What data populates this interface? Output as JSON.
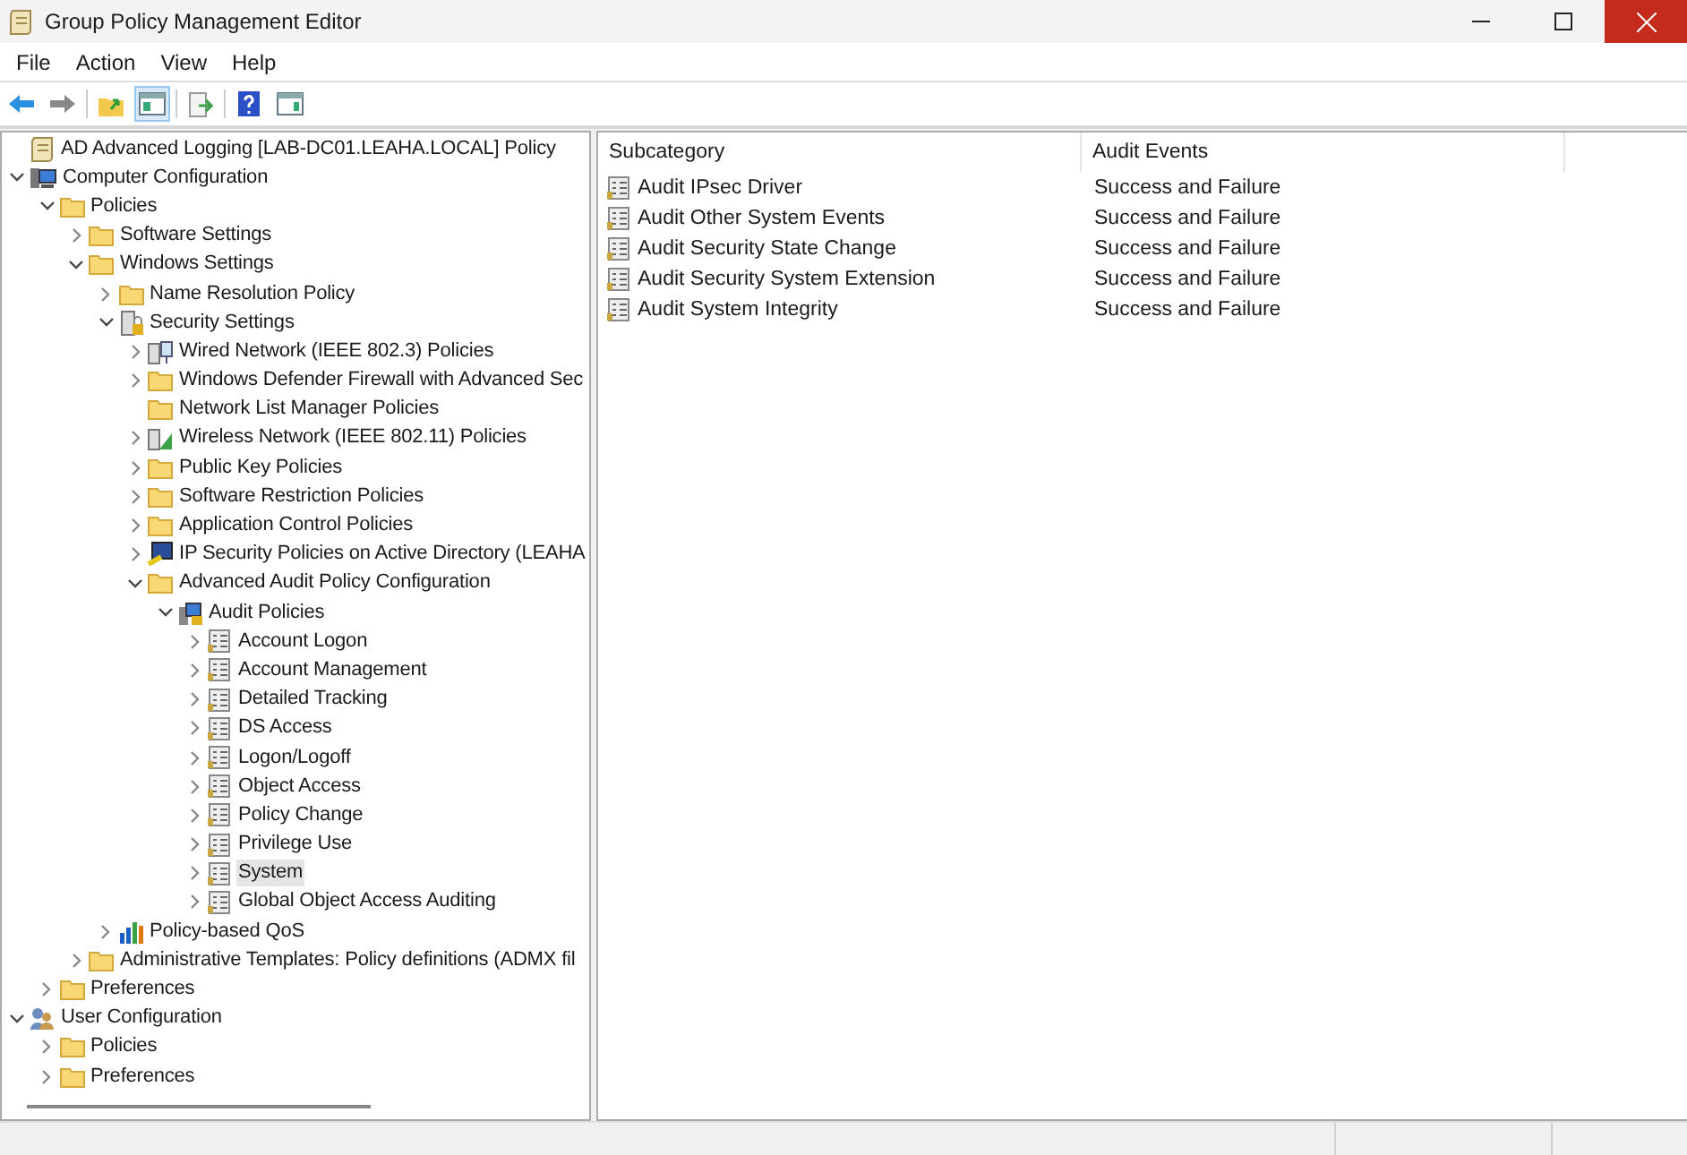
{
  "window": {
    "title": "Group Policy Management Editor"
  },
  "menu": [
    "File",
    "Action",
    "View",
    "Help"
  ],
  "toolbar": [
    {
      "kind": "back"
    },
    {
      "kind": "forward"
    },
    {
      "kind": "sep"
    },
    {
      "kind": "up"
    },
    {
      "kind": "tree",
      "selected": true
    },
    {
      "kind": "sep"
    },
    {
      "kind": "export"
    },
    {
      "kind": "sep"
    },
    {
      "kind": "help"
    },
    {
      "kind": "pane"
    }
  ],
  "tree": [
    {
      "label": "AD Advanced Logging [LAB-DC01.LEAHA.LOCAL] Policy",
      "kind": "doc",
      "selected": false
    },
    {
      "label": "Computer Configuration",
      "kind": "computer",
      "expanded": true,
      "selected": false,
      "children": [
        {
          "label": "Policies",
          "kind": "folder",
          "expanded": true,
          "selected": false,
          "children": [
            {
              "label": "Software Settings",
              "kind": "folder",
              "expanded": false,
              "selected": false
            },
            {
              "label": "Windows Settings",
              "kind": "folder",
              "expanded": true,
              "selected": false,
              "children": [
                {
                  "label": "Name Resolution Policy",
                  "kind": "folder",
                  "expanded": false,
                  "selected": false
                },
                {
                  "label": "Security Settings",
                  "kind": "security",
                  "expanded": true,
                  "selected": false,
                  "children": [
                    {
                      "label": "Wired Network (IEEE 802.3) Policies",
                      "kind": "wired",
                      "expanded": false,
                      "selected": false
                    },
                    {
                      "label": "Windows Defender Firewall with Advanced Sec",
                      "kind": "folder",
                      "expanded": false,
                      "selected": false
                    },
                    {
                      "label": "Network List Manager Policies",
                      "kind": "folder",
                      "selected": false
                    },
                    {
                      "label": "Wireless Network (IEEE 802.11) Policies",
                      "kind": "wireless",
                      "expanded": false,
                      "selected": false
                    },
                    {
                      "label": "Public Key Policies",
                      "kind": "folder",
                      "expanded": false,
                      "selected": false
                    },
                    {
                      "label": "Software Restriction Policies",
                      "kind": "folder",
                      "expanded": false,
                      "selected": false
                    },
                    {
                      "label": "Application Control Policies",
                      "kind": "folder",
                      "expanded": false,
                      "selected": false
                    },
                    {
                      "label": "IP Security Policies on Active Directory (LEAHA",
                      "kind": "ipsec",
                      "expanded": false,
                      "selected": false
                    },
                    {
                      "label": "Advanced Audit Policy Configuration",
                      "kind": "folder",
                      "expanded": true,
                      "selected": false,
                      "children": [
                        {
                          "label": "Audit Policies",
                          "kind": "audit",
                          "expanded": true,
                          "selected": false,
                          "children": [
                            {
                              "label": "Account Logon",
                              "kind": "list",
                              "expanded": false,
                              "selected": false
                            },
                            {
                              "label": "Account Management",
                              "kind": "list",
                              "expanded": false,
                              "selected": false
                            },
                            {
                              "label": "Detailed Tracking",
                              "kind": "list",
                              "expanded": false,
                              "selected": false
                            },
                            {
                              "label": "DS Access",
                              "kind": "list",
                              "expanded": false,
                              "selected": false
                            },
                            {
                              "label": "Logon/Logoff",
                              "kind": "list",
                              "expanded": false,
                              "selected": false
                            },
                            {
                              "label": "Object Access",
                              "kind": "list",
                              "expanded": false,
                              "selected": false
                            },
                            {
                              "label": "Policy Change",
                              "kind": "list",
                              "expanded": false,
                              "selected": false
                            },
                            {
                              "label": "Privilege Use",
                              "kind": "list",
                              "expanded": false,
                              "selected": false
                            },
                            {
                              "label": "System",
                              "kind": "list",
                              "expanded": false,
                              "selected": true
                            },
                            {
                              "label": "Global Object Access Auditing",
                              "kind": "list",
                              "expanded": false,
                              "selected": false
                            }
                          ]
                        }
                      ]
                    }
                  ]
                },
                {
                  "label": "Policy-based QoS",
                  "kind": "qos",
                  "expanded": false,
                  "selected": false
                }
              ]
            },
            {
              "label": "Administrative Templates: Policy definitions (ADMX fil",
              "kind": "folder",
              "expanded": false,
              "selected": false
            }
          ]
        },
        {
          "label": "Preferences",
          "kind": "folder",
          "expanded": false,
          "selected": false
        }
      ]
    },
    {
      "label": "User Configuration",
      "kind": "user",
      "expanded": true,
      "selected": false,
      "children": [
        {
          "label": "Policies",
          "kind": "folder",
          "expanded": false,
          "selected": false
        },
        {
          "label": "Preferences",
          "kind": "folder",
          "expanded": false,
          "selected": false
        }
      ]
    }
  ],
  "table": {
    "columns": [
      "Subcategory",
      "Audit Events"
    ],
    "rows": [
      {
        "subcategory": "Audit IPsec Driver",
        "audit_events": "Success and Failure"
      },
      {
        "subcategory": "Audit Other System Events",
        "audit_events": "Success and Failure"
      },
      {
        "subcategory": "Audit Security State Change",
        "audit_events": "Success and Failure"
      },
      {
        "subcategory": "Audit Security System Extension",
        "audit_events": "Success and Failure"
      },
      {
        "subcategory": "Audit System Integrity",
        "audit_events": "Success and Failure"
      }
    ]
  }
}
